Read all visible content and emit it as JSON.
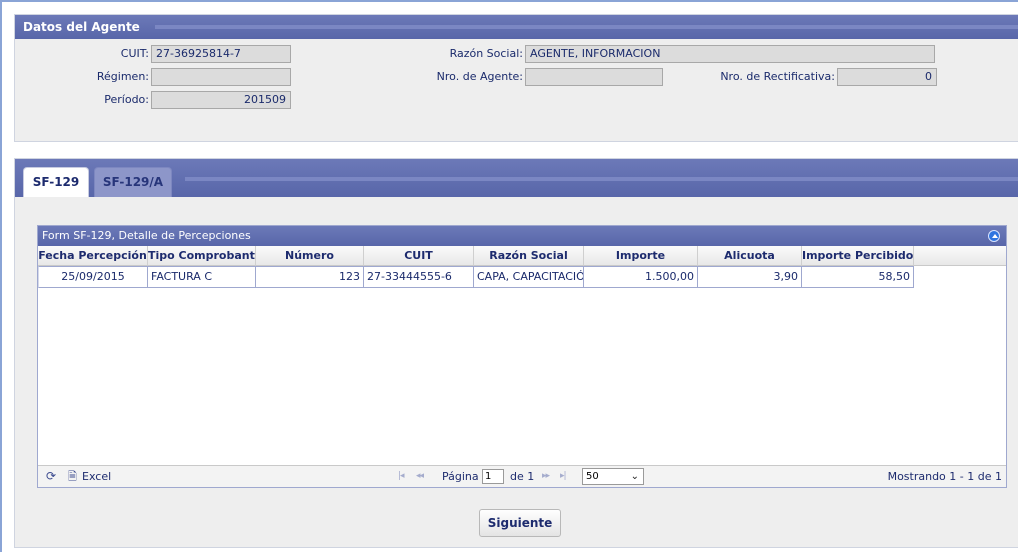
{
  "agent_panel": {
    "title": "Datos del Agente",
    "cuit_label": "CUIT:",
    "cuit_value": "27-36925814-7",
    "regimen_label": "Régimen:",
    "regimen_value": "",
    "periodo_label": "Período:",
    "periodo_value": "201509",
    "razon_social_label": "Razón Social:",
    "razon_social_value": "AGENTE, INFORMACION",
    "nro_agente_label": "Nro. de Agente:",
    "nro_agente_value": "",
    "nro_rectificativa_label": "Nro. de Rectificativa:",
    "nro_rectificativa_value": "0"
  },
  "tabs": [
    {
      "label": "SF-129",
      "active": true
    },
    {
      "label": "SF-129/A",
      "active": false
    }
  ],
  "grid": {
    "title": "Form SF-129, Detalle de Percepciones",
    "columns": [
      "Fecha Percepción",
      "Tipo Comprobante",
      "Número",
      "CUIT",
      "Razón Social",
      "Importe",
      "Alicuota",
      "Importe Percibido"
    ],
    "rows": [
      {
        "fecha": "25/09/2015",
        "tipo": "FACTURA C",
        "numero": "123",
        "cuit": "27-33444555-6",
        "razon_social": "CAPA, CAPACITACIÓN",
        "importe": "1.500,00",
        "alicuota": "3,90",
        "importe_percibido": "58,50"
      }
    ],
    "footer": {
      "refresh_icon": "refresh-icon",
      "excel_icon": "document-icon",
      "excel_label": "Excel",
      "page_label": "Página",
      "page_value": "1",
      "of_label": "de 1",
      "page_size": "50",
      "showing": "Mostrando 1 - 1 de 1"
    }
  },
  "next_button": "Siguiente",
  "colors": {
    "header": "#5f6cae",
    "text": "#1a2a6b",
    "panel_bg": "#eeeeee"
  }
}
